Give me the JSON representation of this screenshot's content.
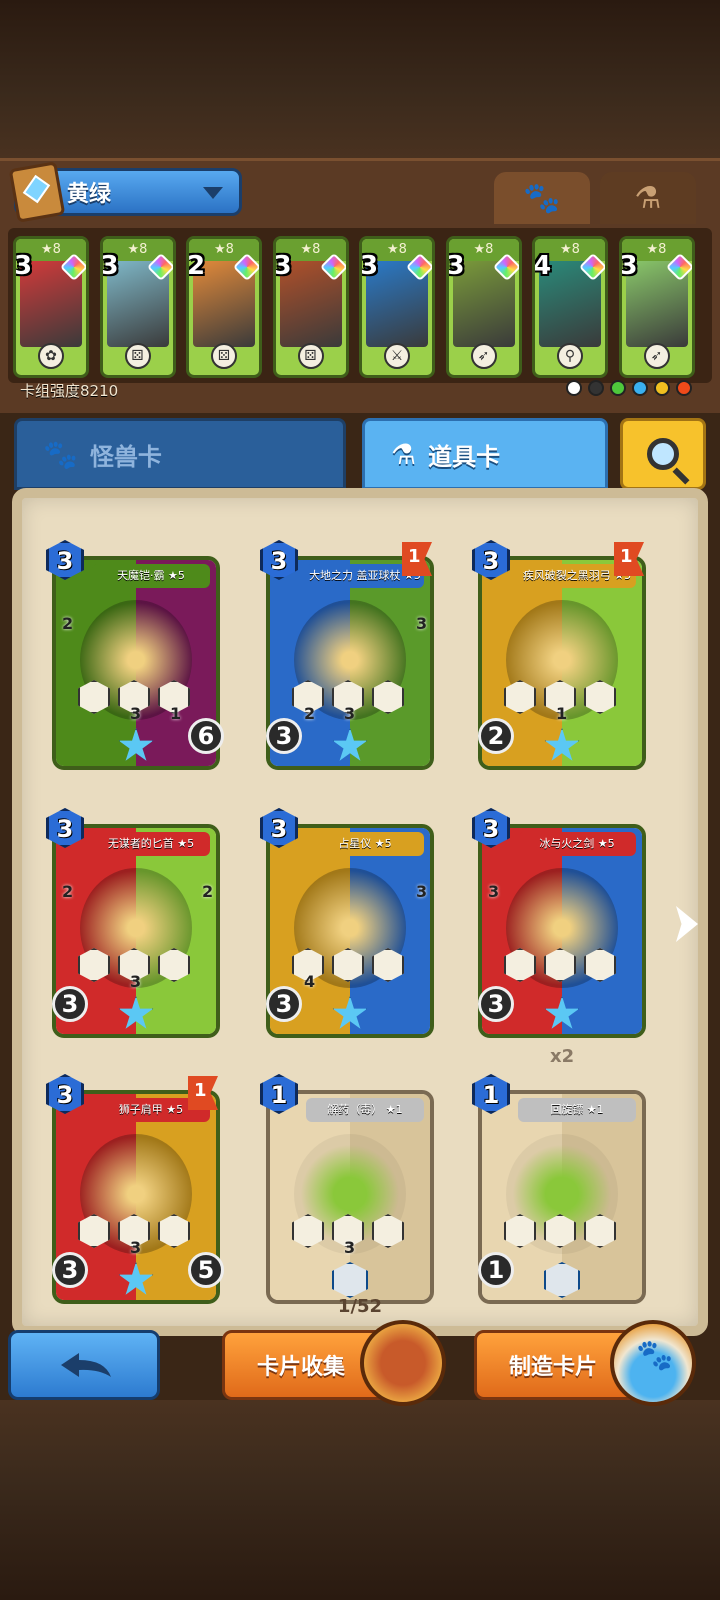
{
  "deck": {
    "name": "黄绿",
    "power_label": "卡组强度8210",
    "cards": [
      {
        "cost": "3",
        "stars": "★8",
        "art_color": "#d23a3a",
        "icon": "mushroom"
      },
      {
        "cost": "3",
        "stars": "★8",
        "art_color": "#7fb8c8",
        "icon": "dice-green"
      },
      {
        "cost": "2",
        "stars": "★8",
        "art_color": "#e28a3a",
        "icon": "dice"
      },
      {
        "cost": "3",
        "stars": "★8",
        "art_color": "#b0502a",
        "icon": "dice"
      },
      {
        "cost": "3",
        "stars": "★8",
        "art_color": "#2a7ac8",
        "icon": "sword"
      },
      {
        "cost": "3",
        "stars": "★8",
        "art_color": "#7a9a3a",
        "icon": "bow"
      },
      {
        "cost": "4",
        "stars": "★8",
        "art_color": "#2a8a7a",
        "icon": "rod"
      },
      {
        "cost": "3",
        "stars": "★8",
        "art_color": "#8ac86a",
        "icon": "bow"
      }
    ],
    "elements": [
      "#ffffff",
      "#333333",
      "#4ec83c",
      "#3ab0f0",
      "#f0c020",
      "#f04a1a"
    ]
  },
  "tabs": {
    "monster_label": "怪兽卡",
    "item_label": "道具卡"
  },
  "cards": [
    {
      "title": "天魔铠·霸 ★5",
      "cost": "3",
      "flag": "",
      "left_num": "2",
      "right_num": "",
      "stat1": "",
      "stat2": "3",
      "stat3": "1",
      "corner": "6",
      "corner_left": "",
      "colors": [
        "#4e8a1a",
        "#7a1a5a"
      ]
    },
    {
      "title": "大地之力 盖亚球杖 ★5",
      "cost": "3",
      "flag": "1",
      "left_num": "",
      "right_num": "3",
      "stat1": "2",
      "stat2": "3",
      "stat3": "",
      "corner": "",
      "corner_left": "3",
      "colors": [
        "#2a6ac8",
        "#5a9a2a"
      ]
    },
    {
      "title": "疾风破裂之黑羽弓 ★5",
      "cost": "3",
      "flag": "1",
      "left_num": "",
      "right_num": "",
      "stat1": "",
      "stat2": "1",
      "stat3": "",
      "corner": "",
      "corner_left": "2",
      "colors": [
        "#d8a020",
        "#8ac83a"
      ]
    },
    {
      "title": "无谋者的匕首 ★5",
      "cost": "3",
      "flag": "",
      "left_num": "2",
      "right_num": "2",
      "stat1": "",
      "stat2": "3",
      "stat3": "",
      "corner": "",
      "corner_left": "3",
      "colors": [
        "#d02a2a",
        "#8ac83a"
      ]
    },
    {
      "title": "占星仪 ★5",
      "cost": "3",
      "flag": "",
      "left_num": "",
      "right_num": "3",
      "stat1": "4",
      "stat2": "",
      "stat3": "",
      "corner": "",
      "corner_left": "3",
      "colors": [
        "#d8a020",
        "#2a6ac8"
      ]
    },
    {
      "title": "冰与火之剑 ★5",
      "cost": "3",
      "flag": "",
      "left_num": "3",
      "right_num": "",
      "stat1": "",
      "stat2": "",
      "stat3": "",
      "corner": "",
      "corner_left": "3",
      "colors": [
        "#d02a2a",
        "#2a6ac8"
      ]
    },
    {
      "title": "狮子肩甲 ★5",
      "cost": "3",
      "flag": "1",
      "left_num": "",
      "right_num": "",
      "stat1": "",
      "stat2": "3",
      "stat3": "",
      "corner": "5",
      "corner_left": "3",
      "colors": [
        "#d02a2a",
        "#d8a020"
      ]
    },
    {
      "title": "解药（毒） ★1",
      "cost": "1",
      "flag": "",
      "left_num": "",
      "right_num": "",
      "stat1": "",
      "stat2": "3",
      "stat3": "",
      "corner": "",
      "corner_left": "",
      "colors": [
        "#e8d6b0",
        "#d8c49a"
      ]
    },
    {
      "title": "回旋镖 ★1",
      "cost": "1",
      "flag": "",
      "left_num": "",
      "right_num": "",
      "stat1": "",
      "stat2": "",
      "stat3": "",
      "corner": "",
      "corner_left": "1",
      "colors": [
        "#e8d6b0",
        "#d8c49a"
      ]
    }
  ],
  "multiplier": "x2",
  "paging": "1/52",
  "buttons": {
    "collect_label": "卡片收集",
    "craft_label": "制造卡片"
  }
}
